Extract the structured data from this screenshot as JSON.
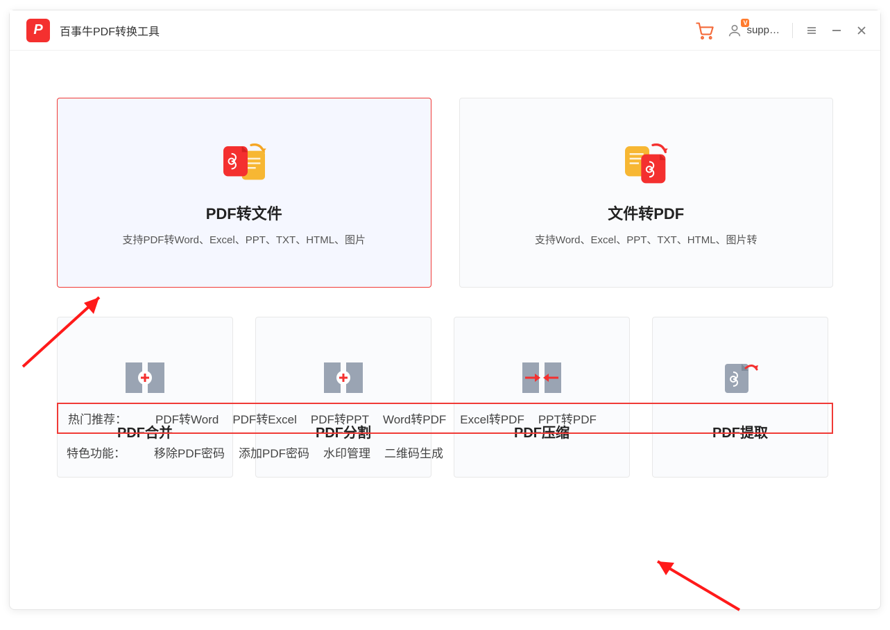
{
  "titlebar": {
    "app_name": "百事牛PDF转换工具",
    "logo_letter": "P",
    "user_label": "supp…",
    "vip_badge": "V"
  },
  "cards": {
    "big": [
      {
        "title": "PDF转文件",
        "subtitle": "支持PDF转Word、Excel、PPT、TXT、HTML、图片"
      },
      {
        "title": "文件转PDF",
        "subtitle": "支持Word、Excel、PPT、TXT、HTML、图片转"
      }
    ],
    "small": [
      {
        "title": "PDF合并"
      },
      {
        "title": "PDF分割"
      },
      {
        "title": "PDF压缩"
      },
      {
        "title": "PDF提取"
      }
    ]
  },
  "footer": {
    "hot_label": "热门推荐：",
    "hot_links": [
      "PDF转Word",
      "PDF转Excel",
      "PDF转PPT",
      "Word转PDF",
      "Excel转PDF",
      "PPT转PDF"
    ],
    "feature_label": "特色功能：",
    "feature_links": [
      "移除PDF密码",
      "添加PDF密码",
      "水印管理",
      "二维码生成"
    ]
  }
}
